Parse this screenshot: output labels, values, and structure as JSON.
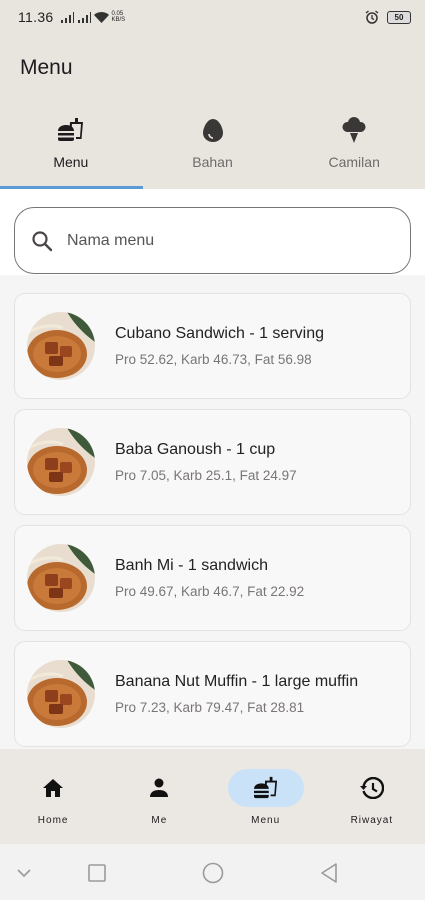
{
  "status_bar": {
    "time": "11.36",
    "net_speed_value": "0.05",
    "net_speed_unit": "KB/S",
    "battery": "50"
  },
  "app_bar": {
    "title": "Menu"
  },
  "tabs": [
    {
      "label": "Menu",
      "icon": "fastfood-icon",
      "active": true
    },
    {
      "label": "Bahan",
      "icon": "egg-icon",
      "active": false
    },
    {
      "label": "Camilan",
      "icon": "icecream-icon",
      "active": false
    }
  ],
  "search": {
    "placeholder": "Nama menu",
    "value": ""
  },
  "menu_items": [
    {
      "title": "Cubano Sandwich - 1 serving",
      "macros": "Pro 52.62, Karb 46.73, Fat 56.98"
    },
    {
      "title": "Baba Ganoush - 1 cup",
      "macros": "Pro 7.05, Karb 25.1, Fat 24.97"
    },
    {
      "title": "Banh Mi - 1 sandwich",
      "macros": "Pro 49.67, Karb 46.7, Fat 22.92"
    },
    {
      "title": "Banana Nut Muffin - 1 large muffin",
      "macros": "Pro 7.23, Karb 79.47, Fat 28.81"
    }
  ],
  "bottom_nav": [
    {
      "label": "Home",
      "icon": "home-icon",
      "active": false
    },
    {
      "label": "Me",
      "icon": "person-icon",
      "active": false
    },
    {
      "label": "Menu",
      "icon": "fastfood-icon",
      "active": true
    },
    {
      "label": "Riwayat",
      "icon": "history-icon",
      "active": false
    }
  ],
  "colors": {
    "header_bg": "#e8e4de",
    "tab_indicator": "#5b9bd5",
    "nav_active_pill": "#c9e2f8",
    "card_bg": "#f8f8f8"
  }
}
